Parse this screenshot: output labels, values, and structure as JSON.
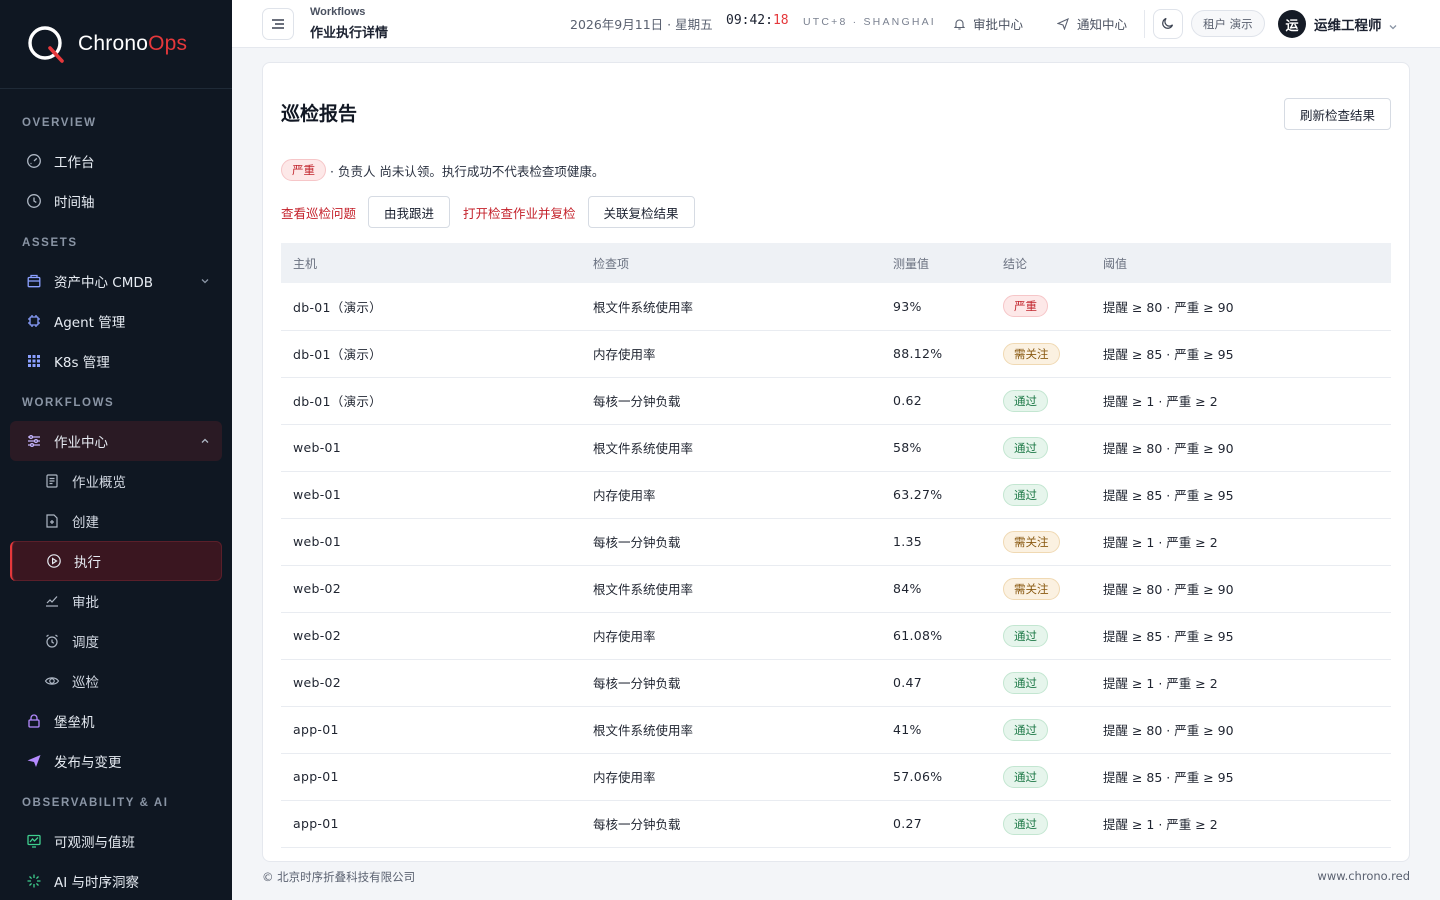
{
  "brand": {
    "name_part1": "Chrono",
    "name_part2": "Ops",
    "accent": "#e5383b"
  },
  "sidebar": {
    "sections": [
      {
        "title": "OVERVIEW"
      },
      {
        "title": "ASSETS"
      },
      {
        "title": "WORKFLOWS"
      },
      {
        "title": "OBSERVABILITY & AI"
      }
    ],
    "items": {
      "workbench": {
        "label": "工作台",
        "icon": "gauge-icon"
      },
      "timeline": {
        "label": "时间轴",
        "icon": "clock-icon"
      },
      "cmdb": {
        "label": "资产中心 CMDB",
        "icon": "package-icon"
      },
      "agent": {
        "label": "Agent 管理",
        "icon": "chip-icon"
      },
      "k8s": {
        "label": "K8s 管理",
        "icon": "grid-icon"
      },
      "jobs": {
        "label": "作业中心",
        "icon": "sliders-icon"
      },
      "jobs_overview": {
        "label": "作业概览",
        "icon": "document-icon"
      },
      "jobs_create": {
        "label": "创建",
        "icon": "file-plus-icon"
      },
      "jobs_execute": {
        "label": "执行",
        "icon": "play-circle-icon"
      },
      "jobs_approve": {
        "label": "审批",
        "icon": "check-chart-icon"
      },
      "jobs_schedule": {
        "label": "调度",
        "icon": "alarm-icon"
      },
      "jobs_inspect": {
        "label": "巡检",
        "icon": "eye-icon"
      },
      "bastion": {
        "label": "堡垒机",
        "icon": "lock-icon"
      },
      "release": {
        "label": "发布与变更",
        "icon": "send-icon"
      },
      "observability": {
        "label": "可观测与值班",
        "icon": "monitor-icon"
      },
      "ai": {
        "label": "AI 与时序洞察",
        "icon": "sparkle-icon"
      }
    }
  },
  "topbar": {
    "breadcrumb_parent": "Workflows",
    "breadcrumb_title": "作业执行详情",
    "date": "2026年9月11日 · 星期五",
    "time_hm": "09:42:",
    "time_s": "18",
    "timezone": "UTC+8 · SHANGHAI",
    "approval_center": "审批中心",
    "notification_center": "通知中心",
    "tenant": "租户 演示",
    "avatar_char": "运",
    "username": "运维工程师"
  },
  "report": {
    "title": "巡检报告",
    "refresh_label": "刷新检查结果",
    "alert_severity": "严重",
    "alert_text": "· 负责人 尚未认领。执行成功不代表检查项健康。",
    "actions": {
      "view_issues": "查看巡检问题",
      "follow_up": "由我跟进",
      "open_recheck": "打开检查作业并复检",
      "link_recheck": "关联复检结果"
    },
    "columns": [
      "主机",
      "检查项",
      "测量值",
      "结论",
      "阈值"
    ],
    "rows": [
      {
        "host": "db-01（演示）",
        "check": "根文件系统使用率",
        "value": "93%",
        "verdict": "严重",
        "level": "critical",
        "threshold": "提醒 ≥ 80 · 严重 ≥ 90"
      },
      {
        "host": "db-01（演示）",
        "check": "内存使用率",
        "value": "88.12%",
        "verdict": "需关注",
        "level": "warn",
        "threshold": "提醒 ≥ 85 · 严重 ≥ 95"
      },
      {
        "host": "db-01（演示）",
        "check": "每核一分钟负载",
        "value": "0.62",
        "verdict": "通过",
        "level": "pass",
        "threshold": "提醒 ≥ 1 · 严重 ≥ 2"
      },
      {
        "host": "web-01",
        "check": "根文件系统使用率",
        "value": "58%",
        "verdict": "通过",
        "level": "pass",
        "threshold": "提醒 ≥ 80 · 严重 ≥ 90"
      },
      {
        "host": "web-01",
        "check": "内存使用率",
        "value": "63.27%",
        "verdict": "通过",
        "level": "pass",
        "threshold": "提醒 ≥ 85 · 严重 ≥ 95"
      },
      {
        "host": "web-01",
        "check": "每核一分钟负载",
        "value": "1.35",
        "verdict": "需关注",
        "level": "warn",
        "threshold": "提醒 ≥ 1 · 严重 ≥ 2"
      },
      {
        "host": "web-02",
        "check": "根文件系统使用率",
        "value": "84%",
        "verdict": "需关注",
        "level": "warn",
        "threshold": "提醒 ≥ 80 · 严重 ≥ 90"
      },
      {
        "host": "web-02",
        "check": "内存使用率",
        "value": "61.08%",
        "verdict": "通过",
        "level": "pass",
        "threshold": "提醒 ≥ 85 · 严重 ≥ 95"
      },
      {
        "host": "web-02",
        "check": "每核一分钟负载",
        "value": "0.47",
        "verdict": "通过",
        "level": "pass",
        "threshold": "提醒 ≥ 1 · 严重 ≥ 2"
      },
      {
        "host": "app-01",
        "check": "根文件系统使用率",
        "value": "41%",
        "verdict": "通过",
        "level": "pass",
        "threshold": "提醒 ≥ 80 · 严重 ≥ 90"
      },
      {
        "host": "app-01",
        "check": "内存使用率",
        "value": "57.06%",
        "verdict": "通过",
        "level": "pass",
        "threshold": "提醒 ≥ 85 · 严重 ≥ 95"
      },
      {
        "host": "app-01",
        "check": "每核一分钟负载",
        "value": "0.27",
        "verdict": "通过",
        "level": "pass",
        "threshold": "提醒 ≥ 1 · 严重 ≥ 2"
      }
    ]
  },
  "footer": {
    "copyright": "© 北京时序折叠科技有限公司",
    "site": "www.chrono.red"
  }
}
